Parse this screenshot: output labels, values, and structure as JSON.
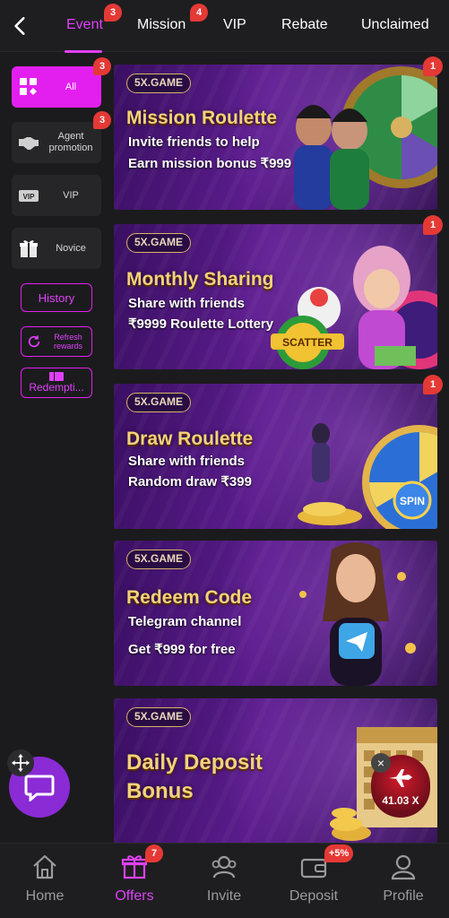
{
  "tabs": [
    {
      "label": "Event",
      "badge": "3",
      "active": true
    },
    {
      "label": "Mission",
      "badge": "4"
    },
    {
      "label": "VIP"
    },
    {
      "label": "Rebate"
    },
    {
      "label": "Unclaimed"
    }
  ],
  "sidebar": {
    "categories": [
      {
        "label": "All",
        "badge": "3",
        "icon": "grid-icon",
        "active": true
      },
      {
        "label": "Agent promotion",
        "badge": "3",
        "icon": "handshake-icon"
      },
      {
        "label": "VIP",
        "icon": "vip-icon"
      },
      {
        "label": "Novice",
        "icon": "gift-icon"
      }
    ],
    "history_label": "History",
    "refresh_label": "Refresh rewards",
    "redemption_label": "Redempti..."
  },
  "banners": [
    {
      "logo": "5X.GAME",
      "title": "Mission Roulette",
      "line1": "Invite friends to help",
      "line2": "Earn mission bonus ₹999",
      "badge": "1"
    },
    {
      "logo": "5X.GAME",
      "title": "Monthly Sharing",
      "line1": "Share with friends",
      "line2": "₹9999 Roulette Lottery",
      "badge": "1",
      "art_text": "SCATTER"
    },
    {
      "logo": "5X.GAME",
      "title": "Draw Roulette",
      "line1": "Share with friends",
      "line2": "Random draw ₹399",
      "badge": "1",
      "art_text": "SPIN"
    },
    {
      "logo": "5X.GAME",
      "title": "Redeem Code",
      "line1": "Telegram channel",
      "line2": "Get ₹999 for free"
    },
    {
      "logo": "5X.GAME",
      "title": "Daily Deposit",
      "line1": "Bonus",
      "line2": ""
    }
  ],
  "floating": {
    "multiplier": "41.03 X",
    "close": "×"
  },
  "bottom_nav": [
    {
      "label": "Home",
      "icon": "home-icon"
    },
    {
      "label": "Offers",
      "icon": "gift-icon",
      "badge": "7",
      "active": true
    },
    {
      "label": "Invite",
      "icon": "users-icon"
    },
    {
      "label": "Deposit",
      "icon": "wallet-icon",
      "badge": "+5%"
    },
    {
      "label": "Profile",
      "icon": "profile-icon"
    }
  ],
  "colors": {
    "accent": "#e31ff0",
    "badge": "#e53935",
    "background": "#1b1b1d"
  }
}
